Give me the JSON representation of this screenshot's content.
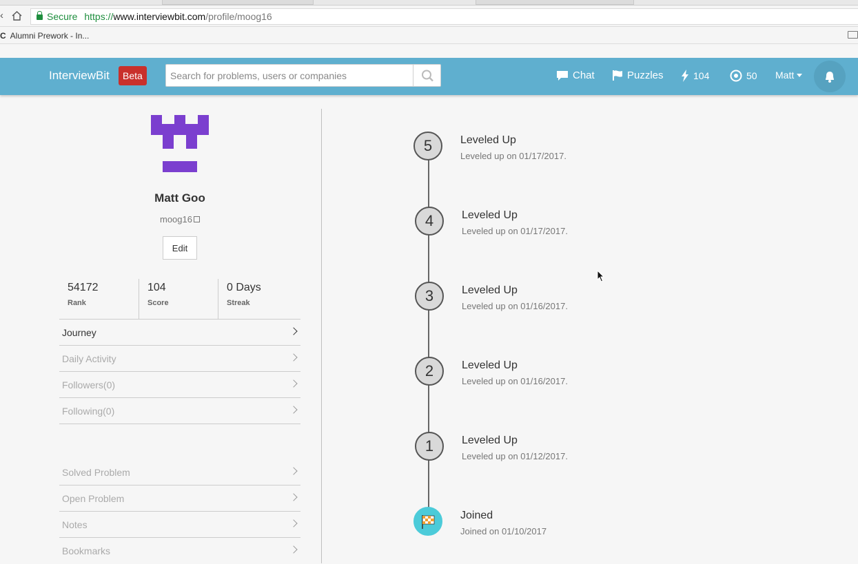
{
  "browser": {
    "address": {
      "secure_label": "Secure",
      "scheme": "https://",
      "host": "www.interviewbit.com",
      "path": "/profile/moog16"
    },
    "bookmarks": [
      {
        "icon": "C",
        "label": "Alumni Prework - In..."
      }
    ]
  },
  "header": {
    "brand": "InterviewBit",
    "badge": "Beta",
    "search_placeholder": "Search for problems, users or companies",
    "links": {
      "chat": "Chat",
      "puzzles": "Puzzles",
      "score": "104",
      "coins": "50",
      "user": "Matt"
    }
  },
  "profile": {
    "name": "Matt Goo",
    "username": "moog16",
    "edit_label": "Edit",
    "stats": [
      {
        "value": "54172",
        "label": "Rank"
      },
      {
        "value": "104",
        "label": "Score"
      },
      {
        "value": "0 Days",
        "label": "Streak"
      }
    ],
    "menu_primary": [
      "Journey",
      "Daily Activity",
      "Followers(0)",
      "Following(0)"
    ],
    "menu_secondary": [
      "Solved Problem",
      "Open Problem",
      "Notes",
      "Bookmarks"
    ]
  },
  "timeline": [
    {
      "badge": "5",
      "title": "Leveled Up",
      "desc": "Leveled up on 01/17/2017."
    },
    {
      "badge": "4",
      "title": "Leveled Up",
      "desc": "Leveled up on 01/17/2017."
    },
    {
      "badge": "3",
      "title": "Leveled Up",
      "desc": "Leveled up on 01/16/2017."
    },
    {
      "badge": "2",
      "title": "Leveled Up",
      "desc": "Leveled up on 01/16/2017."
    },
    {
      "badge": "1",
      "title": "Leveled Up",
      "desc": "Leveled up on 01/12/2017."
    },
    {
      "badge": "",
      "title": "Joined",
      "desc": "Joined on 01/10/2017"
    }
  ],
  "colors": {
    "header_bg": "#5fafcf",
    "beta_bg": "#c9302c",
    "avatar": "#7b3fcf",
    "joined_node": "#4ccbd9",
    "secure_green": "#1e8e3e"
  }
}
